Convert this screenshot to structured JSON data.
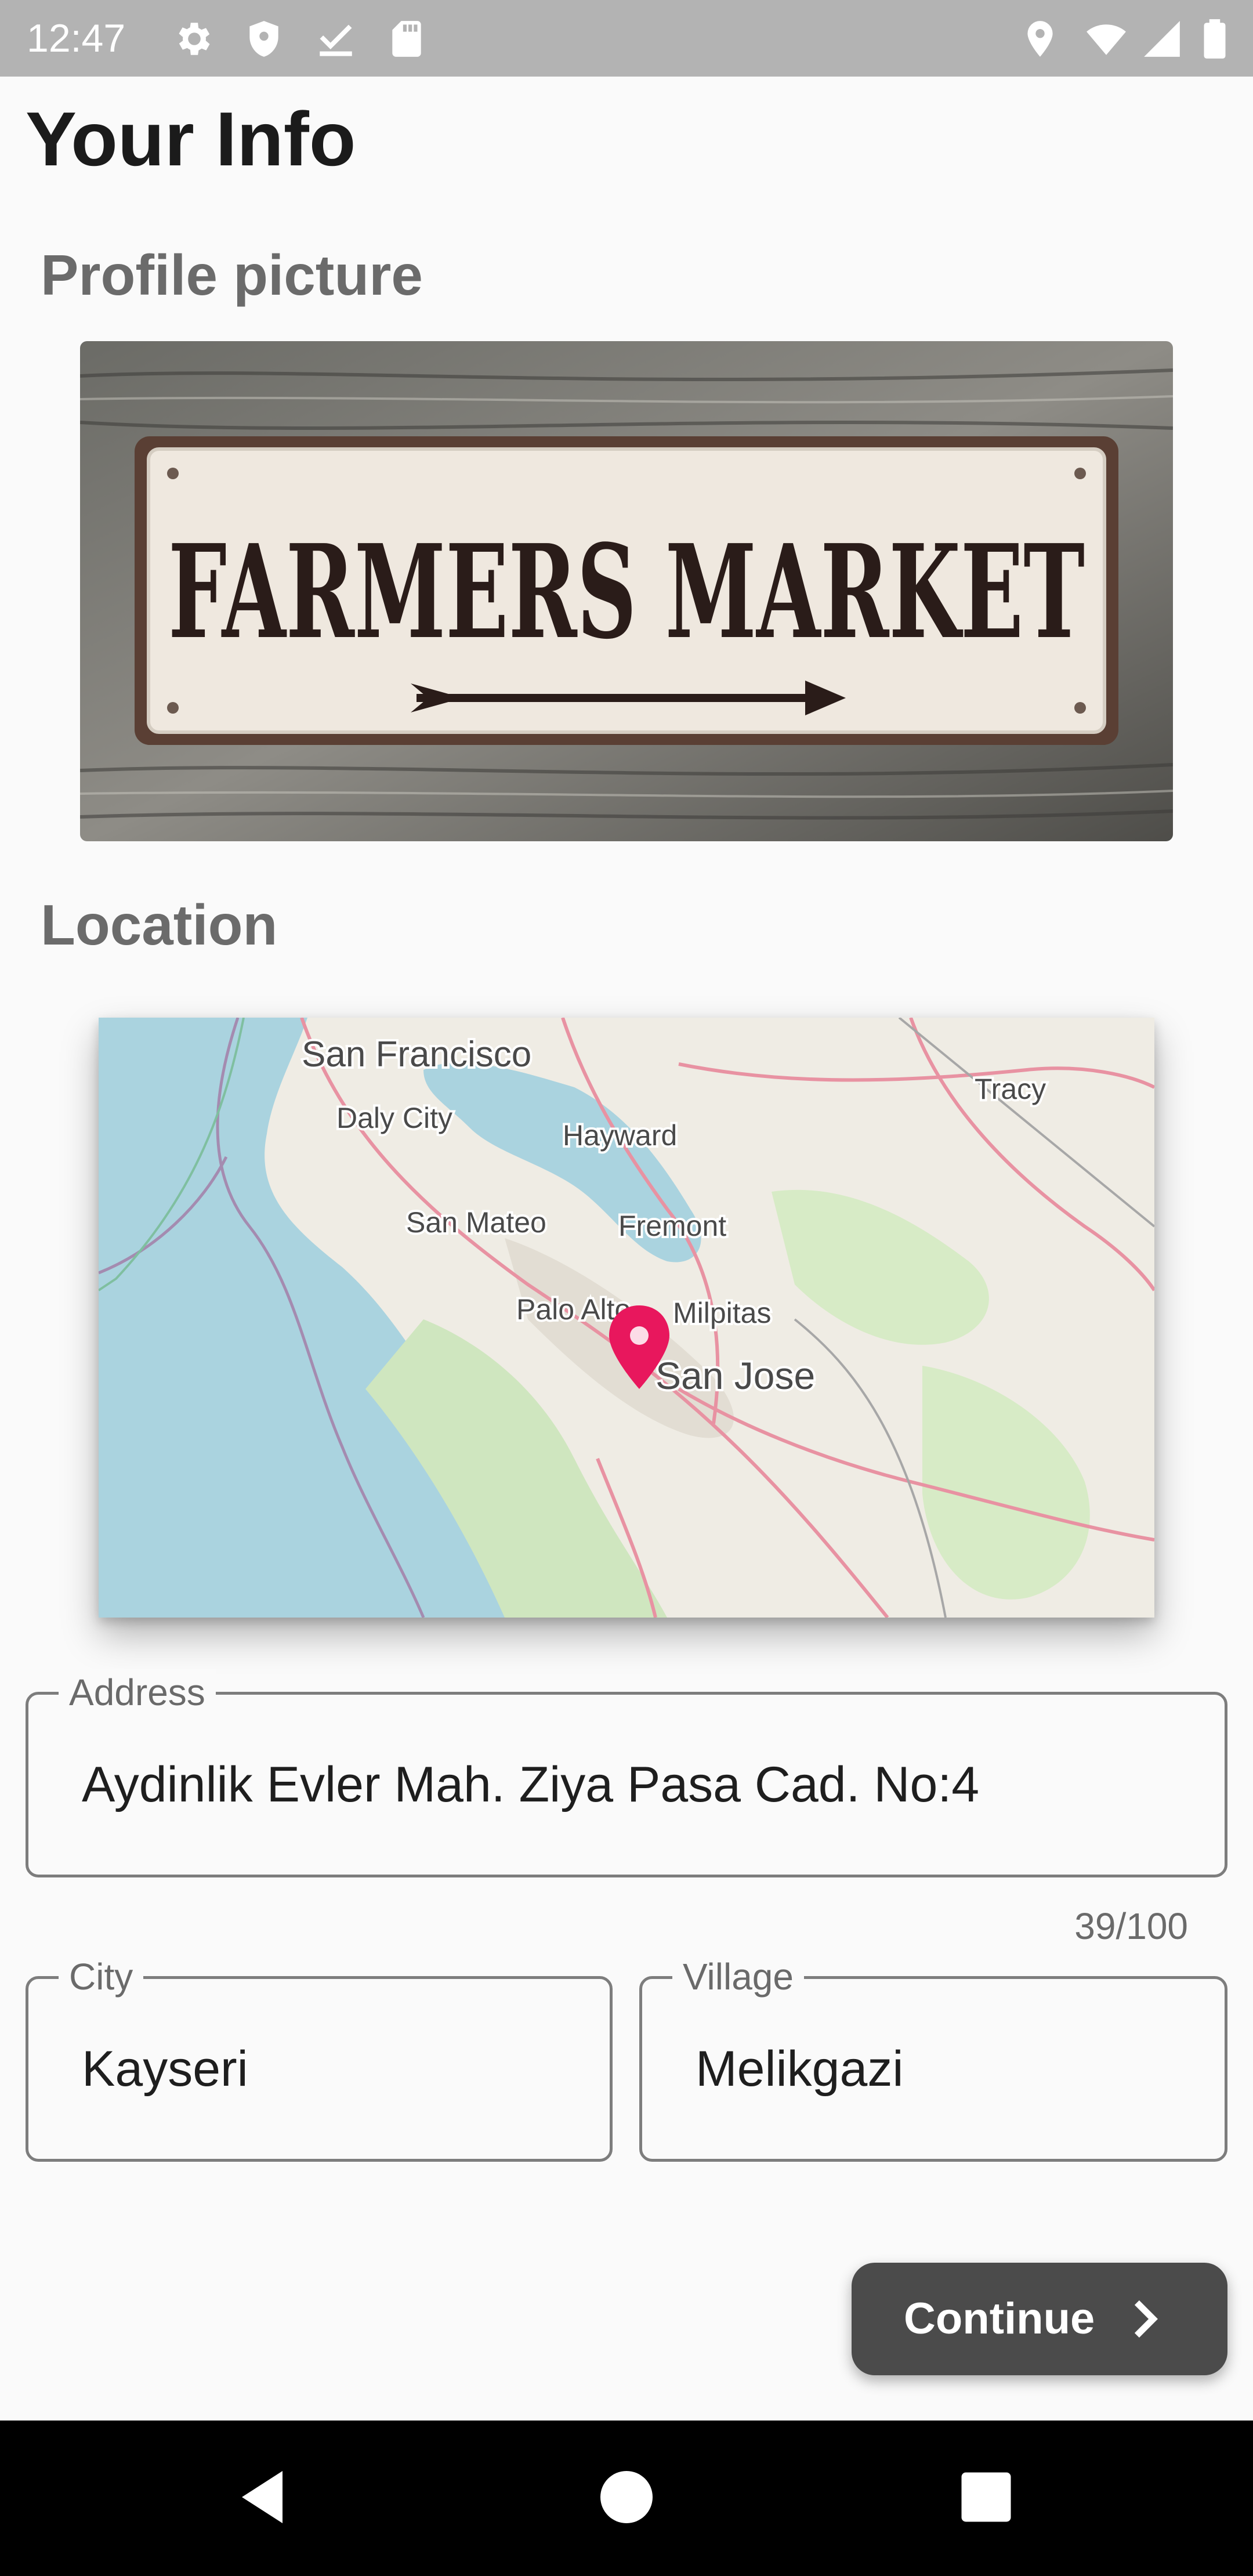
{
  "status_bar": {
    "time": "12:47",
    "icons_left": [
      "settings-gear-icon",
      "shield-icon",
      "download-done-icon",
      "sd-card-icon"
    ],
    "icons_right": [
      "location-pin-icon",
      "wifi-icon",
      "cell-signal-icon",
      "battery-icon"
    ]
  },
  "page": {
    "title": "Your Info"
  },
  "profile": {
    "section_title": "Profile picture",
    "image_text": "FARMERS MARKET"
  },
  "location": {
    "section_title": "Location",
    "map_labels": [
      "San Francisco",
      "Daly City",
      "Hayward",
      "Tracy",
      "San Mateo",
      "Fremont",
      "Palo Alto",
      "Milpitas",
      "San Jose"
    ],
    "marker_color": "#e8175d"
  },
  "form": {
    "address": {
      "label": "Address",
      "value": "Aydinlik Evler Mah. Ziya Pasa Cad. No:4",
      "counter": "39/100"
    },
    "city": {
      "label": "City",
      "value": "Kayseri"
    },
    "village": {
      "label": "Village",
      "value": "Melikgazi"
    }
  },
  "actions": {
    "continue_label": "Continue"
  },
  "nav": {
    "buttons": [
      "back-icon",
      "home-icon",
      "recents-icon"
    ]
  },
  "colors": {
    "status_bar": "#b3b3b3",
    "button": "#4b4b4b",
    "background": "#fafafa"
  }
}
